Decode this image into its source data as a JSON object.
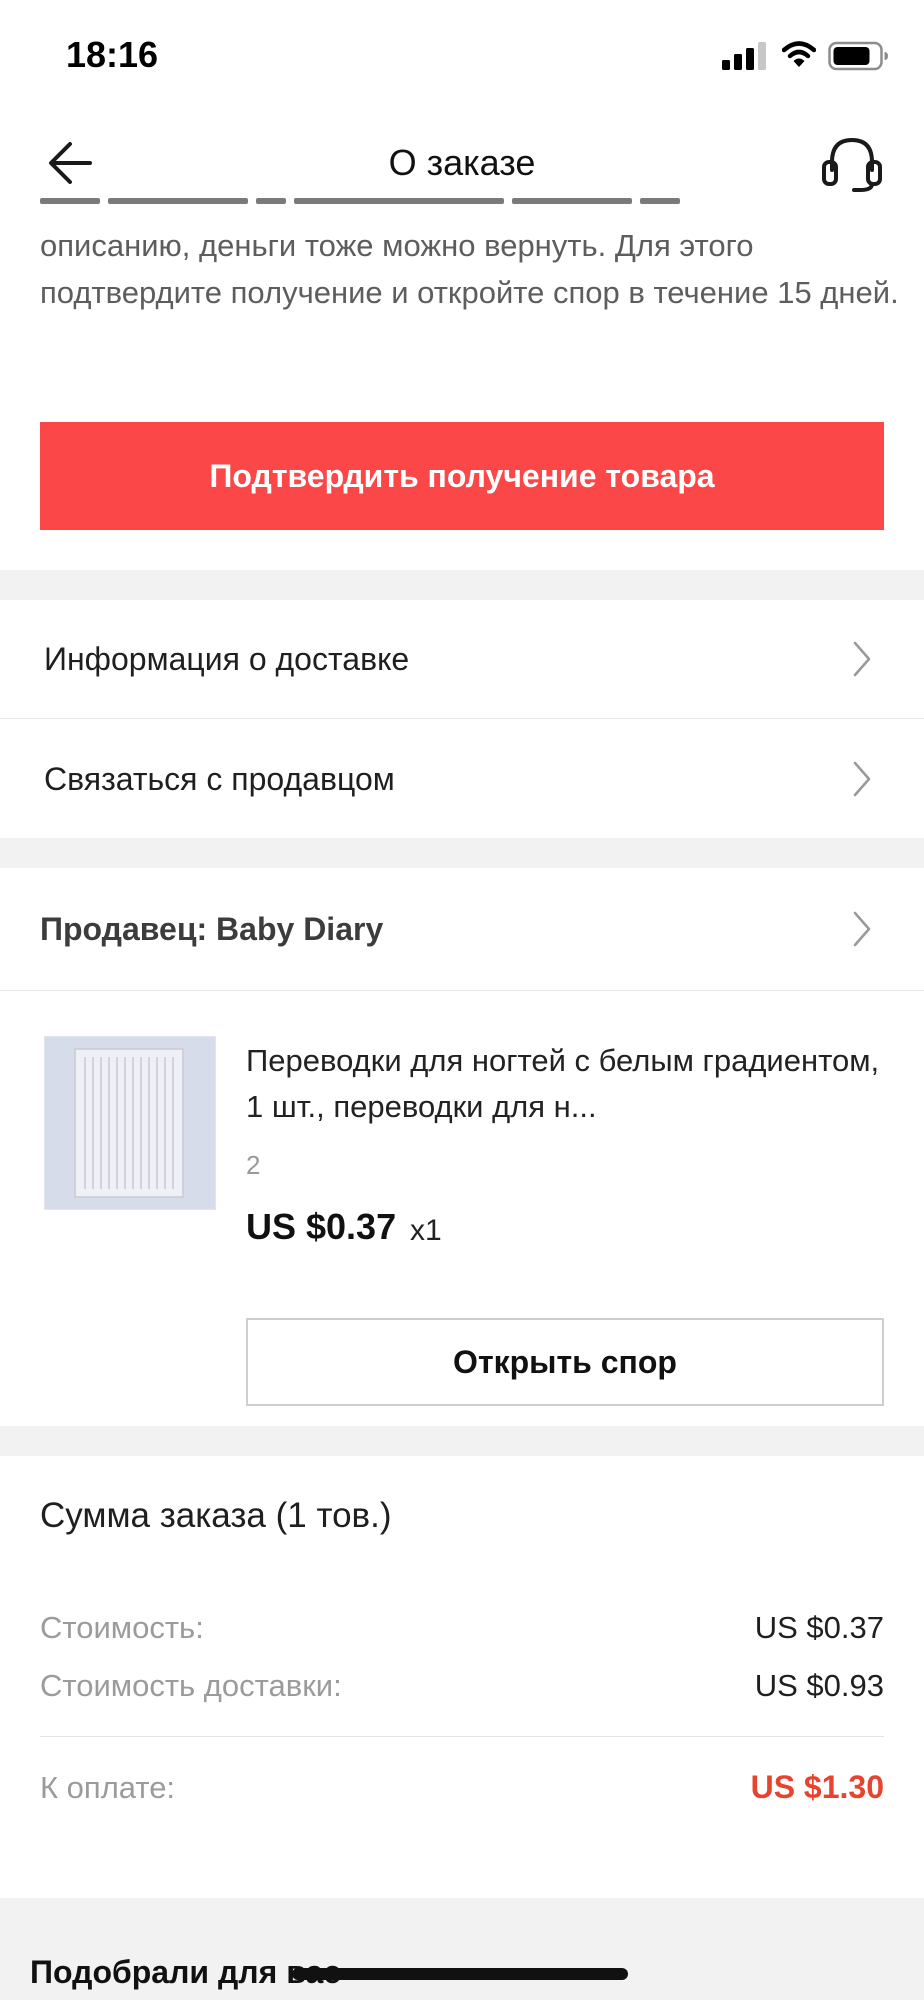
{
  "status_bar": {
    "time": "18:16"
  },
  "header": {
    "title": "О заказе"
  },
  "info": {
    "text": "описанию, деньги тоже можно вернуть. Для этого подтвердите получение и откройте спор в течение 15 дней."
  },
  "actions": {
    "confirm_label": "Подтвердить получение товара"
  },
  "menu": {
    "delivery_info": "Информация о доставке",
    "contact_seller": "Связаться с продавцом"
  },
  "seller": {
    "label": "Продавец: Baby Diary"
  },
  "product": {
    "title": "Переводки для ногтей с белым градиентом, 1 шт., переводки для н...",
    "variant": "2",
    "price": "US $0.37",
    "quantity": "x1",
    "dispute_label": "Открыть спор"
  },
  "summary": {
    "title": "Сумма заказа (1 тов.)",
    "cost_label": "Стоимость:",
    "cost_value": "US $0.37",
    "shipping_label": "Стоимость доставки:",
    "shipping_value": "US $0.93",
    "total_label": "К оплате:",
    "total_value": "US $1.30"
  },
  "recommendations": {
    "title": "Подобрали для вас"
  },
  "colors": {
    "accent": "#fb4747",
    "total": "#e8432f",
    "section_gap": "#f2f2f2"
  }
}
